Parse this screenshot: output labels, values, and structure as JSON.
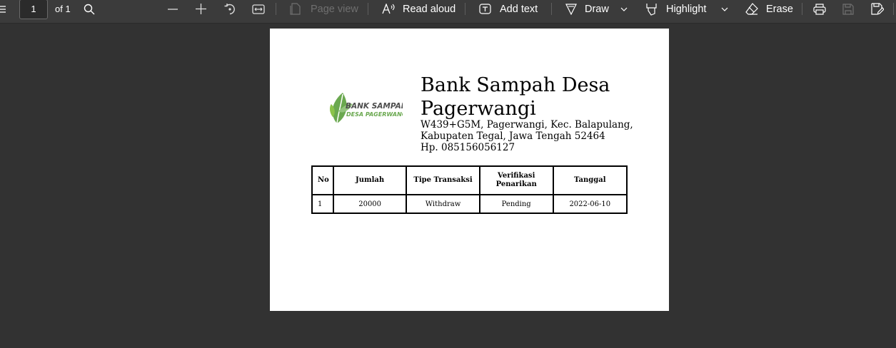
{
  "toolbar": {
    "page_number": "1",
    "page_total": "of 1",
    "page_view_label": "Page view",
    "read_aloud_label": "Read aloud",
    "add_text_label": "Add text",
    "draw_label": "Draw",
    "highlight_label": "Highlight",
    "erase_label": "Erase"
  },
  "document": {
    "logo_text_top": "BANK SAMPAH",
    "logo_text_bottom": "DESA PAGERWANGI",
    "title": "Bank Sampah Desa Pagerwangi",
    "address_line1": "W439+G5M, Pagerwangi, Kec. Balapulang,",
    "address_line2": "Kabupaten Tegal, Jawa Tengah 52464",
    "phone": "Hp. 085156056127",
    "table": {
      "headers": [
        "No",
        "Jumlah",
        "Tipe Transaksi",
        "Verifikasi Penarikan",
        "Tanggal"
      ],
      "rows": [
        [
          "1",
          "20000",
          "Withdraw",
          "Pending",
          "2022-06-10"
        ]
      ]
    }
  },
  "colors": {
    "toolbar_bg": "#3b3b3b",
    "viewer_bg": "#323232",
    "logo_green": "#6aa84f"
  }
}
